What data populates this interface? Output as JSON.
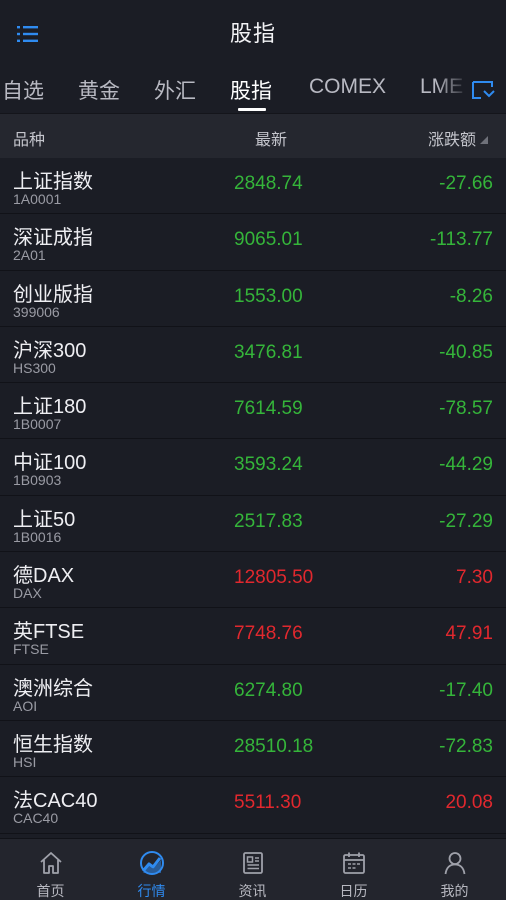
{
  "header": {
    "title": "股指"
  },
  "tabs": [
    {
      "label": "自选",
      "active": false
    },
    {
      "label": "黄金",
      "active": false
    },
    {
      "label": "外汇",
      "active": false
    },
    {
      "label": "股指",
      "active": true
    },
    {
      "label": "COMEX",
      "active": false
    },
    {
      "label": "LME",
      "active": false
    }
  ],
  "columns": {
    "name": "品种",
    "price": "最新",
    "change": "涨跌额"
  },
  "rows": [
    {
      "name": "上证指数",
      "code": "1A0001",
      "price": "2848.74",
      "change": "-27.66",
      "trend": "down"
    },
    {
      "name": "深证成指",
      "code": "2A01",
      "price": "9065.01",
      "change": "-113.77",
      "trend": "down"
    },
    {
      "name": "创业版指",
      "code": "399006",
      "price": "1553.00",
      "change": "-8.26",
      "trend": "down"
    },
    {
      "name": "沪深300",
      "code": "HS300",
      "price": "3476.81",
      "change": "-40.85",
      "trend": "down"
    },
    {
      "name": "上证180",
      "code": "1B0007",
      "price": "7614.59",
      "change": "-78.57",
      "trend": "down"
    },
    {
      "name": "中证100",
      "code": "1B0903",
      "price": "3593.24",
      "change": "-44.29",
      "trend": "down"
    },
    {
      "name": "上证50",
      "code": "1B0016",
      "price": "2517.83",
      "change": "-27.29",
      "trend": "down"
    },
    {
      "name": "德DAX",
      "code": "DAX",
      "price": "12805.50",
      "change": "7.30",
      "trend": "up"
    },
    {
      "name": "英FTSE",
      "code": "FTSE",
      "price": "7748.76",
      "change": "47.91",
      "trend": "up"
    },
    {
      "name": "澳洲综合",
      "code": "AOI",
      "price": "6274.80",
      "change": "-17.40",
      "trend": "down"
    },
    {
      "name": "恒生指数",
      "code": "HSI",
      "price": "28510.18",
      "change": "-72.83",
      "trend": "down"
    },
    {
      "name": "法CAC40",
      "code": "CAC40",
      "price": "5511.30",
      "change": "20.08",
      "trend": "up"
    }
  ],
  "nav": [
    {
      "label": "首页",
      "icon": "home-icon",
      "active": false
    },
    {
      "label": "行情",
      "icon": "market-chart-icon",
      "active": true
    },
    {
      "label": "资讯",
      "icon": "news-icon",
      "active": false
    },
    {
      "label": "日历",
      "icon": "calendar-icon",
      "active": false
    },
    {
      "label": "我的",
      "icon": "profile-icon",
      "active": false
    }
  ],
  "colors": {
    "up": "#e1282e",
    "down": "#35b53a",
    "accent": "#2f8bf0",
    "background": "#1b1d25"
  }
}
